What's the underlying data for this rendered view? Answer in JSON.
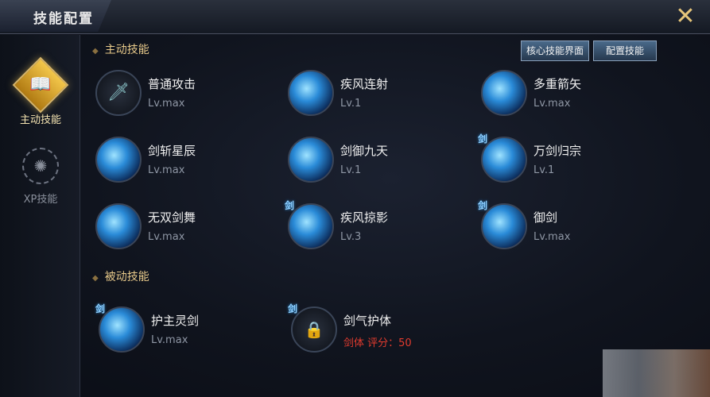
{
  "window": {
    "title": "技能配置",
    "close_icon": "close-icon"
  },
  "sidebar": {
    "tabs": [
      {
        "label": "主动技能",
        "icon": "book-icon",
        "active": true
      },
      {
        "label": "XP技能",
        "icon": "xp-emblem-icon",
        "active": false
      }
    ]
  },
  "active_section": {
    "heading": "主动技能",
    "buttons": [
      {
        "label": "核心技能界面"
      },
      {
        "label": "配置技能"
      }
    ],
    "skills": [
      {
        "name": "普通攻击",
        "level": "Lv.max",
        "icon": "sword-icon"
      },
      {
        "name": "疾风连射",
        "level": "Lv.1",
        "icon": "skill-gale-icon"
      },
      {
        "name": "多重箭矢",
        "level": "Lv.max",
        "icon": "skill-arrows-icon"
      },
      {
        "name": "剑斩星辰",
        "level": "Lv.max",
        "icon": "skill-slash-icon"
      },
      {
        "name": "剑御九天",
        "level": "Lv.1",
        "icon": "skill-burst-icon"
      },
      {
        "name": "万剑归宗",
        "level": "Lv.1",
        "icon": "skill-figure-icon",
        "badge": "剑"
      },
      {
        "name": "无双剑舞",
        "level": "Lv.max",
        "icon": "skill-dance-icon"
      },
      {
        "name": "疾风掠影",
        "level": "Lv.3",
        "icon": "skill-shadow-icon",
        "badge": "剑"
      },
      {
        "name": "御剑",
        "level": "Lv.max",
        "icon": "skill-ride-icon",
        "badge": "剑"
      }
    ]
  },
  "passive_section": {
    "heading": "被动技能",
    "skills": [
      {
        "name": "护主灵剑",
        "level": "Lv.max",
        "icon": "skill-guard-icon",
        "badge": "剑"
      },
      {
        "name": "剑气护体",
        "level": "剑体 评分：50",
        "icon": "lock-icon",
        "badge": "剑",
        "locked": true
      }
    ]
  },
  "colors": {
    "heading": "#e7c98a",
    "level_text": "#8e96a4",
    "locked_requirement": "#e23b2e",
    "accent_gold": "#e6c57a"
  }
}
